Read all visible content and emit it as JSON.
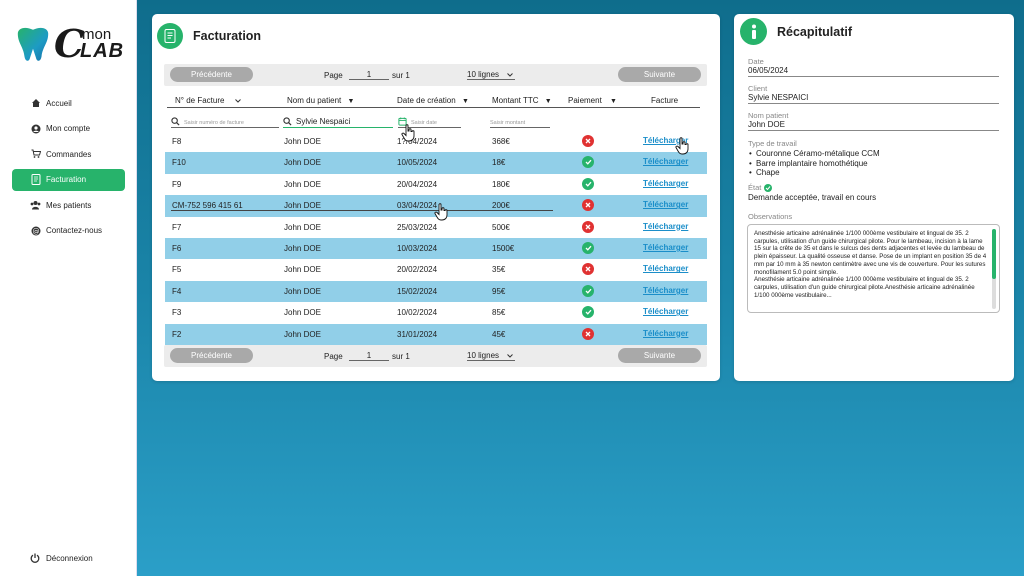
{
  "brand": {
    "mon": "mon",
    "lab": "LAB",
    "c": "C"
  },
  "nav": [
    {
      "label": "Accueil",
      "icon": "home-icon"
    },
    {
      "label": "Mon compte",
      "icon": "user-icon"
    },
    {
      "label": "Commandes",
      "icon": "cart-icon"
    },
    {
      "label": "Facturation",
      "icon": "invoice-icon",
      "active": true
    },
    {
      "label": "Mes patients",
      "icon": "patients-icon"
    },
    {
      "label": "Contactez-nous",
      "icon": "at-icon"
    }
  ],
  "logout": "Déconnexion",
  "billing": {
    "title": "Facturation",
    "pager_top": {
      "prev": "Précédente",
      "next": "Suivante",
      "page_label": "Page",
      "page": "1",
      "of_label": "sur 1",
      "rows": "10 lignes"
    },
    "pager_bottom": {
      "prev": "Précédente",
      "next": "Suivante",
      "page_label": "Page",
      "page": "1",
      "of_label": "sur 1",
      "rows": "10 lignes"
    },
    "columns": [
      "N° de Facture",
      "Nom du patient",
      "Date de création",
      "Montant TTC",
      "Paiement",
      "Facture"
    ],
    "filters": {
      "invoice_placeholder": "Saisir numéro de facture",
      "patient_value": "Sylvie Nespaici",
      "date_placeholder": "Saisir date",
      "amount_placeholder": "Saisir montant"
    },
    "rows": [
      {
        "id": "F8",
        "patient": "John DOE",
        "date": "1?/04/2024",
        "amount": "368€",
        "paid": false,
        "link": "Télécharger"
      },
      {
        "id": "F10",
        "patient": "John DOE",
        "date": "10/05/2024",
        "amount": "18€",
        "paid": true,
        "link": "Télécharger"
      },
      {
        "id": "F9",
        "patient": "John DOE",
        "date": "20/04/2024",
        "amount": "180€",
        "paid": true,
        "link": "Télécharger"
      },
      {
        "id": "CM-752 596 415 61",
        "patient": "John DOE",
        "date": "03/04/2024",
        "amount": "200€",
        "paid": false,
        "link": "Télécharger"
      },
      {
        "id": "F7",
        "patient": "John DOE",
        "date": "25/03/2024",
        "amount": "500€",
        "paid": false,
        "link": "Télécharger"
      },
      {
        "id": "F6",
        "patient": "John DOE",
        "date": "10/03/2024",
        "amount": "1500€",
        "paid": true,
        "link": "Télécharger"
      },
      {
        "id": "F5",
        "patient": "John DOE",
        "date": "20/02/2024",
        "amount": "35€",
        "paid": false,
        "link": "Télécharger"
      },
      {
        "id": "F4",
        "patient": "John DOE",
        "date": "15/02/2024",
        "amount": "95€",
        "paid": true,
        "link": "Télécharger"
      },
      {
        "id": "F3",
        "patient": "John DOE",
        "date": "10/02/2024",
        "amount": "85€",
        "paid": true,
        "link": "Télécharger"
      },
      {
        "id": "F2",
        "patient": "John DOE",
        "date": "31/01/2024",
        "amount": "45€",
        "paid": false,
        "link": "Télécharger"
      }
    ]
  },
  "recap": {
    "title": "Récapitulatif",
    "date_label": "Date",
    "date": "06/05/2024",
    "client_label": "Client",
    "client": "Sylvie NESPAICI",
    "patient_label": "Nom patient",
    "patient": "John DOE",
    "work_label": "Type de travail",
    "work": [
      "Couronne Céramo-métalique CCM",
      "Barre implantaire homothétique",
      "Chape"
    ],
    "state_label": "État",
    "state": "Demande acceptée, travail en cours",
    "obs_label": "Observations",
    "observations": "Anesthésie articaine adrénalinée 1/100 000ème vestibulaire et lingual de 35. 2 carpules, utilisation d'un guide chirurgical pilote. Pour le lambeau, incision à la lame 15 sur la crête de 35 et dans le sulcus des dents adjacentes et levée du lambeau de plein épaisseur. La qualité osseuse et danse. Pose de un implant en position 35 de 4 mm par 10 mm à 35 newton centimètre avec une vis de couverture. Pour les sutures monofilament 5.0 point simple.\nAnesthésie articaine adrénalinée 1/100 000ème vestibulaire et lingual de 35. 2 carpules, utilisation d'un guide chirurgical pilote.Anesthésie articaine adrénalinée 1/100 000ème vestibulaire..."
  },
  "colors": {
    "accent": "#27b36b",
    "row_alt": "#91cfe8",
    "link": "#1b8ec9",
    "error": "#e03232"
  }
}
